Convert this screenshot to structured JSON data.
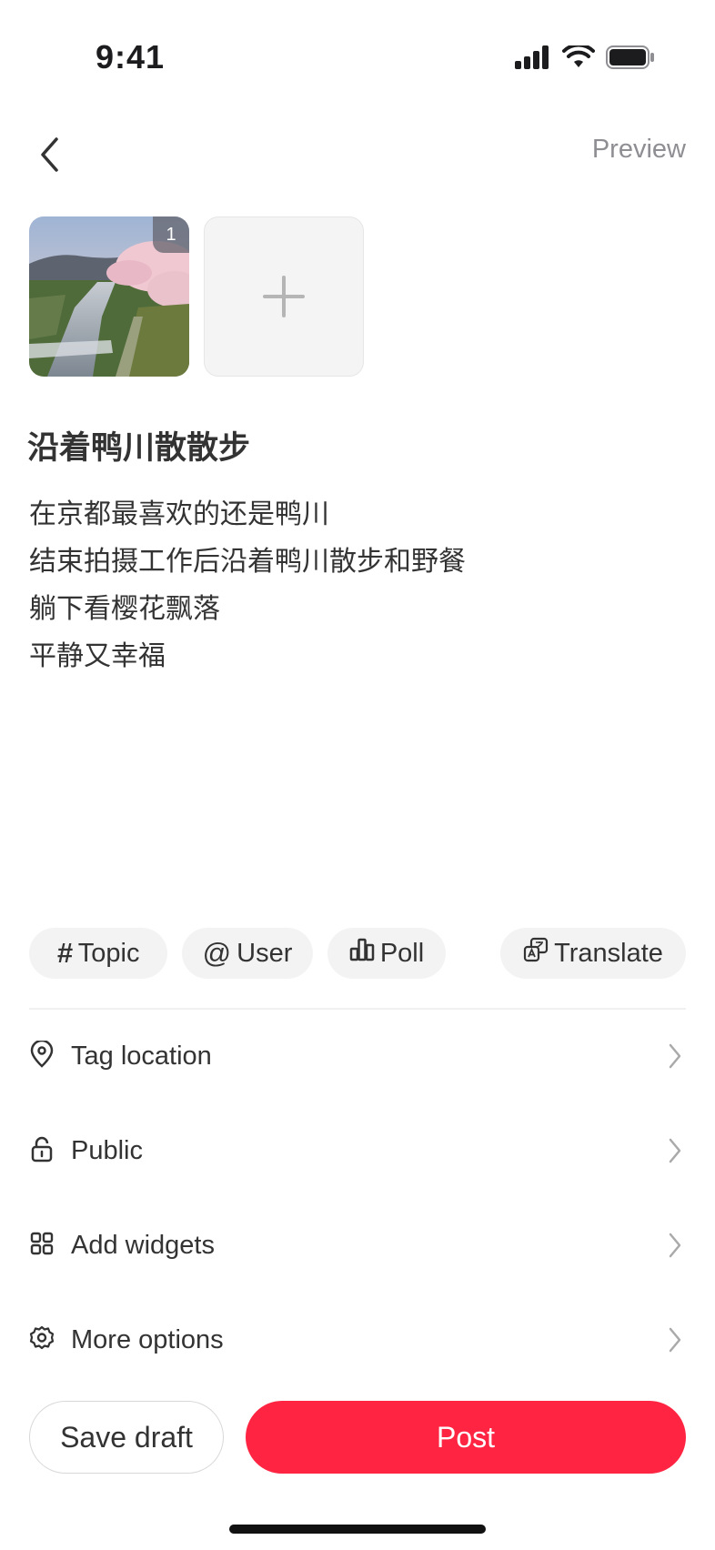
{
  "status_bar": {
    "time": "9:41"
  },
  "nav": {
    "preview_label": "Preview"
  },
  "photos": [
    {
      "badge": "1"
    }
  ],
  "post": {
    "title": "沿着鸭川散散步",
    "body_lines": [
      "在京都最喜欢的还是鸭川",
      "结束拍摄工作后沿着鸭川散步和野餐",
      "躺下看樱花飘落",
      "平静又幸福"
    ]
  },
  "chips": [
    {
      "label": "Topic",
      "icon": "hash-icon"
    },
    {
      "label": "User",
      "icon": "at-icon"
    },
    {
      "label": "Poll",
      "icon": "poll-icon"
    },
    {
      "label": "Translate",
      "icon": "translate-icon"
    }
  ],
  "options": [
    {
      "label": "Tag location",
      "icon": "location-pin-icon"
    },
    {
      "label": "Public",
      "icon": "lock-icon"
    },
    {
      "label": "Add widgets",
      "icon": "widgets-icon"
    },
    {
      "label": "More options",
      "icon": "gear-icon"
    }
  ],
  "actions": {
    "save_draft_label": "Save draft",
    "post_label": "Post"
  },
  "colors": {
    "accent": "#ff2442",
    "muted": "#8e8e93",
    "chip_bg": "#f3f3f3"
  }
}
